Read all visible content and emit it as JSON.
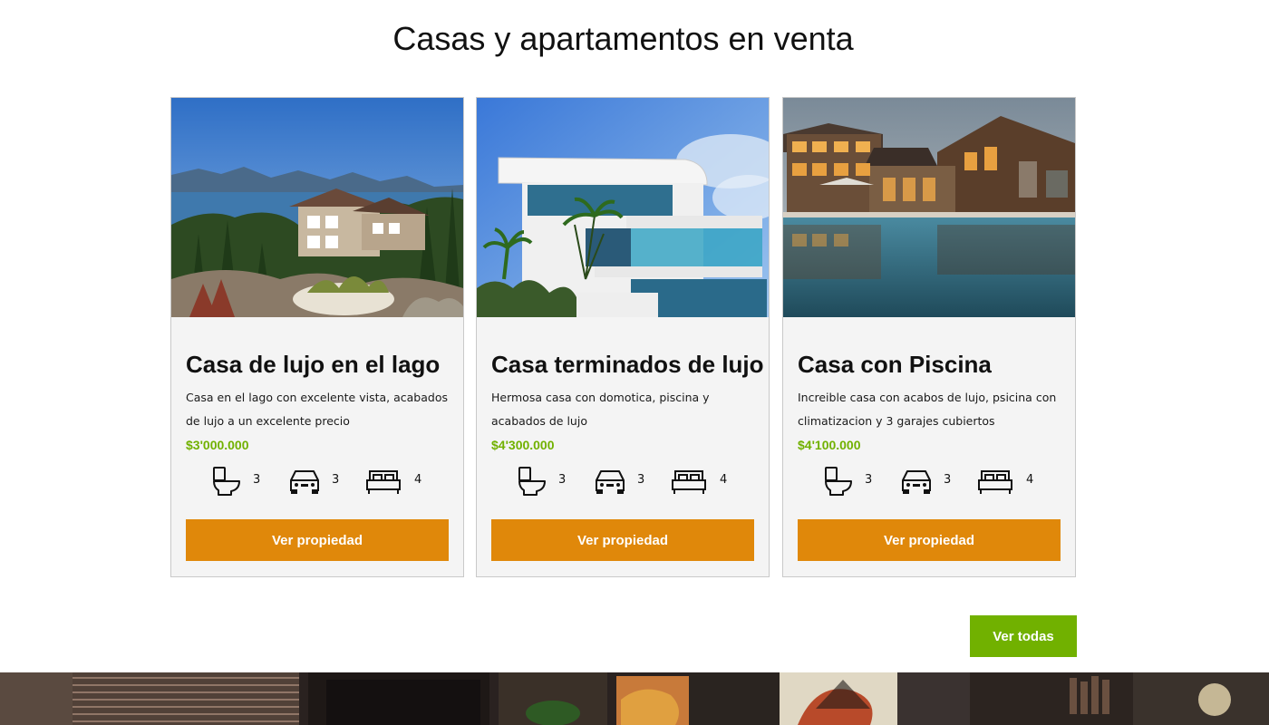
{
  "section": {
    "title": "Casas y apartamentos en venta"
  },
  "cards": [
    {
      "title": "Casa de lujo en el lago",
      "description": "Casa en el lago con excelente vista, acabados de lujo a un excelente precio",
      "price": "$3'000.000",
      "bathrooms": "3",
      "parking": "3",
      "bedrooms": "4",
      "button_label": "Ver propiedad"
    },
    {
      "title": "Casa terminados de lujo",
      "description": "Hermosa casa con domotica, piscina y acabados de lujo",
      "price": "$4'300.000",
      "bathrooms": "3",
      "parking": "3",
      "bedrooms": "4",
      "button_label": "Ver propiedad"
    },
    {
      "title": "Casa con Piscina",
      "description": "Increible casa con acabos de lujo, psicina con climatizacion y 3 garajes cubiertos",
      "price": "$4'100.000",
      "bathrooms": "3",
      "parking": "3",
      "bedrooms": "4",
      "button_label": "Ver propiedad"
    }
  ],
  "all_button_label": "Ver todas",
  "icons": {
    "bathroom": "toilet-icon",
    "parking": "car-icon",
    "bedroom": "bed-icon"
  },
  "colors": {
    "accent_orange": "#e0880a",
    "accent_green": "#71b100",
    "card_bg": "#f4f4f4",
    "card_border": "#c9c9c9"
  }
}
